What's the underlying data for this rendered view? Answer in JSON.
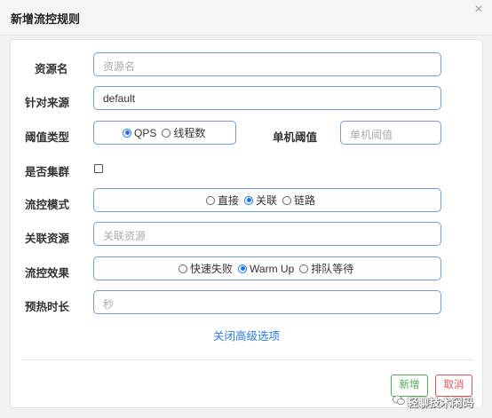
{
  "dialog": {
    "title": "新增流控规则",
    "close_glyph": "×"
  },
  "form": {
    "resource_name": {
      "label": "资源名",
      "placeholder": "资源名",
      "value": ""
    },
    "limit_app": {
      "label": "针对来源",
      "value": "default"
    },
    "grade": {
      "label": "阈值类型",
      "options": [
        {
          "label": "QPS",
          "selected": true
        },
        {
          "label": "线程数",
          "selected": false
        }
      ]
    },
    "single_threshold": {
      "label": "单机阈值",
      "placeholder": "单机阈值",
      "value": ""
    },
    "cluster_mode": {
      "label": "是否集群",
      "checked": false
    },
    "strategy": {
      "label": "流控模式",
      "options": [
        {
          "label": "直接",
          "selected": false
        },
        {
          "label": "关联",
          "selected": true
        },
        {
          "label": "链路",
          "selected": false
        }
      ]
    },
    "ref_resource": {
      "label": "关联资源",
      "placeholder": "关联资源",
      "value": ""
    },
    "control_behavior": {
      "label": "流控效果",
      "options": [
        {
          "label": "快速失败",
          "selected": false
        },
        {
          "label": "Warm Up",
          "selected": true
        },
        {
          "label": "排队等待",
          "selected": false
        }
      ]
    },
    "warmup_period": {
      "label": "预热时长",
      "placeholder": "秒",
      "value": ""
    },
    "advanced_toggle": "关闭高级选项"
  },
  "footer": {
    "add_label": "新增",
    "cancel_label": "取消"
  },
  "watermark": {
    "text": "轻聊技术闲码",
    "icon": "wechat-icon"
  },
  "colors": {
    "accent": "#2a7ae2",
    "field_border": "#6ea1d8",
    "add_button": "#4caf50",
    "cancel_button": "#e05555"
  }
}
